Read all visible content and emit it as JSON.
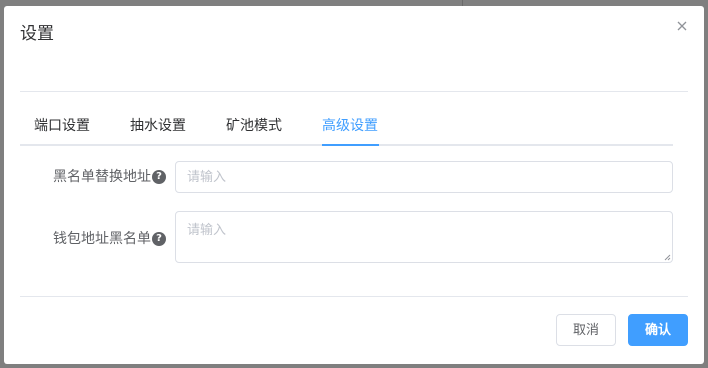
{
  "dialog": {
    "title": "设置",
    "close_icon": "close-icon"
  },
  "tabs": [
    {
      "label": "端口设置",
      "active": false
    },
    {
      "label": "抽水设置",
      "active": false
    },
    {
      "label": "矿池模式",
      "active": false
    },
    {
      "label": "高级设置",
      "active": true
    }
  ],
  "form": {
    "blacklist_replace": {
      "label": "黑名单替换地址",
      "placeholder": "请输入",
      "value": "",
      "help_icon": "question-circle-icon"
    },
    "wallet_blacklist": {
      "label": "钱包地址黑名单",
      "placeholder": "请输入",
      "value": "",
      "help_icon": "question-circle-icon"
    }
  },
  "footer": {
    "cancel_label": "取消",
    "confirm_label": "确认"
  },
  "colors": {
    "accent": "#409eff",
    "overlay": "#7f7f7f",
    "text": "#303133",
    "label": "#606266",
    "border": "#dcdfe6"
  }
}
